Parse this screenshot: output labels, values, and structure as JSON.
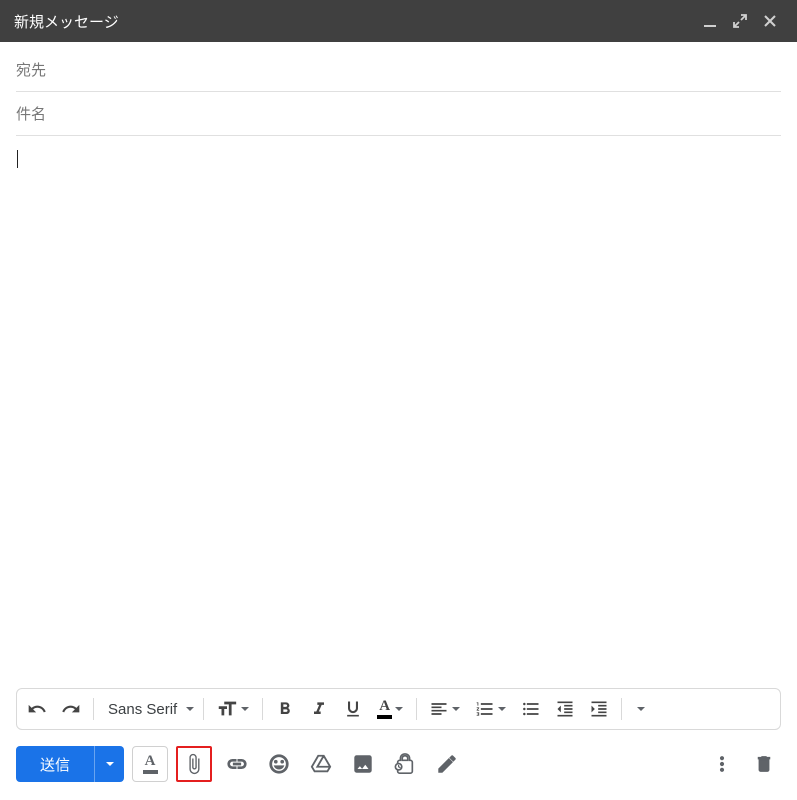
{
  "header": {
    "title": "新規メッセージ",
    "minimize_icon": "minimize-icon",
    "expand_icon": "expand-icon",
    "close_icon": "close-icon"
  },
  "fields": {
    "to_placeholder": "宛先",
    "subject_placeholder": "件名"
  },
  "body": {
    "content": ""
  },
  "format_toolbar": {
    "font_name": "Sans Serif"
  },
  "bottom": {
    "send_label": "送信"
  }
}
